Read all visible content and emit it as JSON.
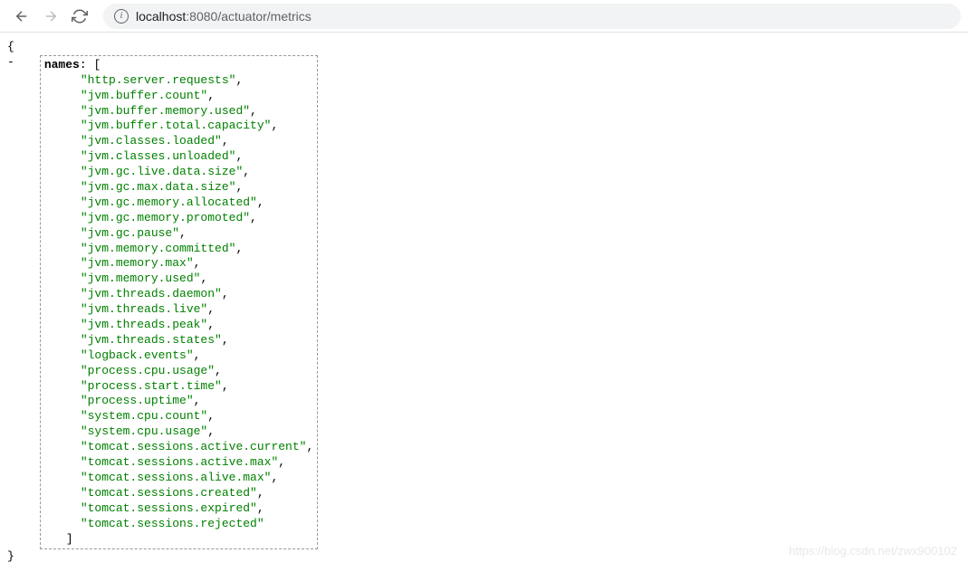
{
  "toolbar": {
    "url_host": "localhost",
    "url_port": ":8080",
    "url_path": "/actuator/metrics"
  },
  "json": {
    "key": "names",
    "collapse": "-",
    "open_brace": "{",
    "close_brace": "}",
    "open_bracket": "[",
    "close_bracket": "]",
    "colon": ":",
    "items": [
      "http.server.requests",
      "jvm.buffer.count",
      "jvm.buffer.memory.used",
      "jvm.buffer.total.capacity",
      "jvm.classes.loaded",
      "jvm.classes.unloaded",
      "jvm.gc.live.data.size",
      "jvm.gc.max.data.size",
      "jvm.gc.memory.allocated",
      "jvm.gc.memory.promoted",
      "jvm.gc.pause",
      "jvm.memory.committed",
      "jvm.memory.max",
      "jvm.memory.used",
      "jvm.threads.daemon",
      "jvm.threads.live",
      "jvm.threads.peak",
      "jvm.threads.states",
      "logback.events",
      "process.cpu.usage",
      "process.start.time",
      "process.uptime",
      "system.cpu.count",
      "system.cpu.usage",
      "tomcat.sessions.active.current",
      "tomcat.sessions.active.max",
      "tomcat.sessions.alive.max",
      "tomcat.sessions.created",
      "tomcat.sessions.expired",
      "tomcat.sessions.rejected"
    ]
  },
  "watermark": "https://blog.csdn.net/zwx900102"
}
